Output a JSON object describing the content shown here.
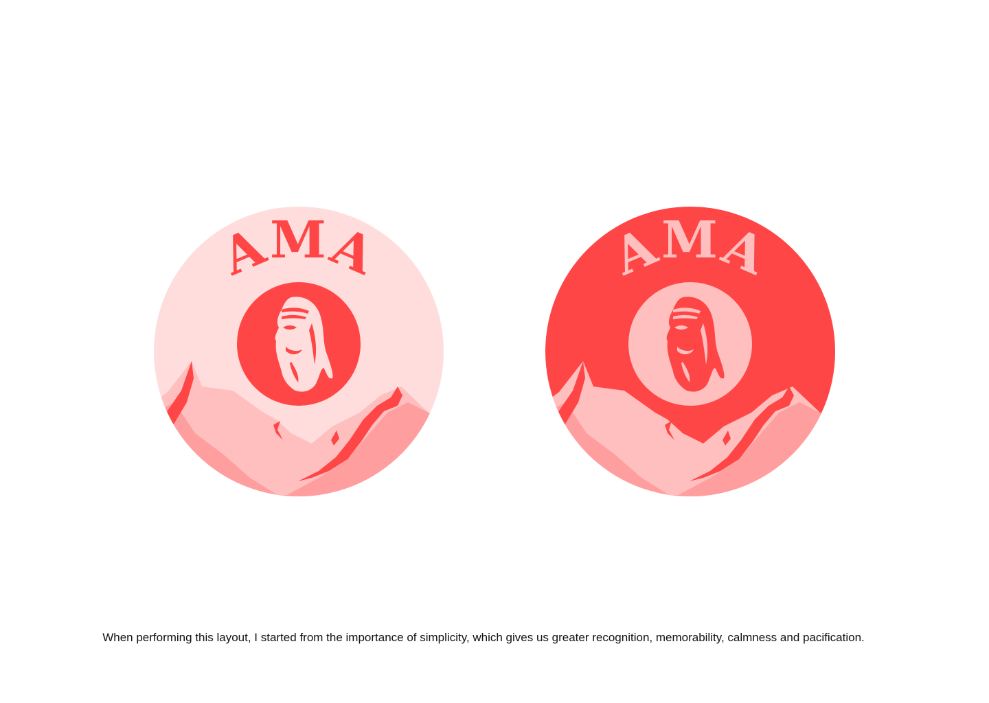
{
  "logos": [
    {
      "variant": "light",
      "brand": "AMA",
      "colors": {
        "background": "#FFDDDC",
        "text": "#FF4646",
        "emblem": "#FF4646",
        "face": "#FFDDDC",
        "mountain_back": "#FFBFBF",
        "mountain_front": "#FF9E9E",
        "mountain_accent": "#FF4646"
      }
    },
    {
      "variant": "dark",
      "brand": "AMA",
      "colors": {
        "background": "#FF4646",
        "text": "#FFBFBF",
        "emblem": "#FFBFBF",
        "face": "#FF4646",
        "mountain_back": "#FFBFBF",
        "mountain_front": "#FF9E9E",
        "mountain_accent": "#FF4646"
      }
    }
  ],
  "caption": "When performing this layout, I started from the importance of simplicity, which gives us greater recognition, memorability, calmness and pacification."
}
